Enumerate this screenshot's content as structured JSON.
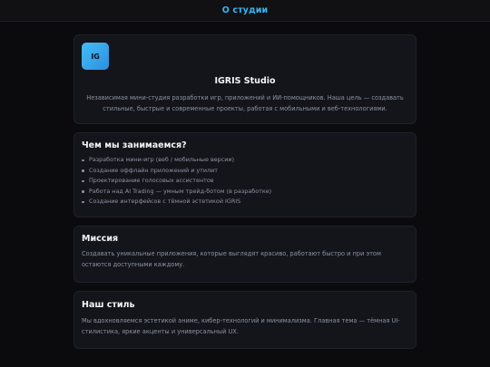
{
  "header": {
    "title": "О студии"
  },
  "hero": {
    "logo_text": "IG",
    "title": "IGRIS Studio",
    "description": "Независимая мини-студия разработки игр, приложений и ИИ-помощников. Наша цель — создавать стильные, быстрые и современные проекты, работая с мобильными и веб-технологиями."
  },
  "what_we_do": {
    "title": "Чем мы занимаемся?",
    "items": [
      "Разработка мини-игр (веб / мобильные версии)",
      "Создание оффлайн приложений и утилит",
      "Проектирование голосовых ассистентов",
      "Работа над AI Trading — умным трейд-ботом (в разработке)",
      "Создание интерфейсов с тёмной эстетикой IGRIS"
    ]
  },
  "mission": {
    "title": "Миссия",
    "text": "Создавать уникальные приложения, которые выглядят красиво, работают быстро и при этом остаются доступными каждому."
  },
  "style": {
    "title": "Наш стиль",
    "text": "Мы вдохновляемся эстетикой аниме, кибер-технологий и минимализма. Главная тема — тёмная UI-стилистика, яркие акценты и универсальный UX."
  },
  "colors": {
    "background": "#0b0b0d",
    "card": "#13151b",
    "accent": "#37b6f0",
    "heading": "#f2f4f7",
    "muted_text": "#8c93a3"
  }
}
